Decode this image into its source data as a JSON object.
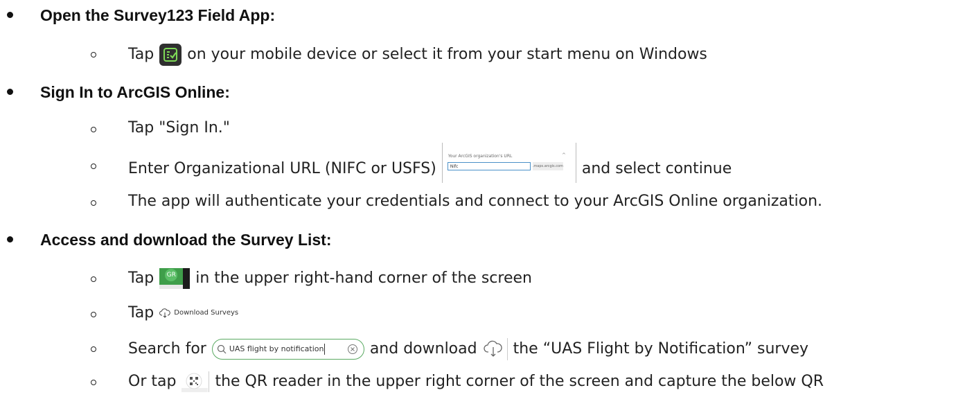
{
  "steps": [
    {
      "heading": "Open the Survey123 Field App:",
      "items": [
        {
          "before": "Tap",
          "after": "on your mobile device or select it from your start menu on Windows"
        }
      ]
    },
    {
      "heading": "Sign In to ArcGIS Online:",
      "items": [
        {
          "text": "Tap \"Sign In.\""
        },
        {
          "before": "Enter Organizational URL (NIFC or USFS)",
          "after": "and select continue"
        },
        {
          "text": "The app will authenticate your credentials and connect to your ArcGIS Online organization."
        }
      ]
    },
    {
      "heading": "Access and download the Survey List:",
      "items": [
        {
          "before": "Tap",
          "after": "in the upper right-hand corner of the screen"
        },
        {
          "before": "Tap"
        },
        {
          "before": "Search for",
          "middle": "and download",
          "after": "the “UAS Flight by Notification” survey"
        },
        {
          "before": "Or tap",
          "after": "the QR reader in the upper right corner of the screen and capture the below QR"
        }
      ]
    }
  ],
  "org_url_widget": {
    "label": "Your ArcGIS organization's URL",
    "chevron": "^",
    "input_value": "Nifc",
    "suffix": ".maps.arcgis.com"
  },
  "profile_icon": {
    "initials": "GR"
  },
  "download_button": {
    "label": "Download Surveys",
    "icon": "cloud-download-icon"
  },
  "search_widget": {
    "value": "UAS flight by notification",
    "icon": "search-icon",
    "clear_icon": "clear-icon"
  },
  "colors": {
    "survey_green": "#3f9e4a",
    "app_icon_bg": "#2f2f2f",
    "search_border": "#5aaa62"
  }
}
